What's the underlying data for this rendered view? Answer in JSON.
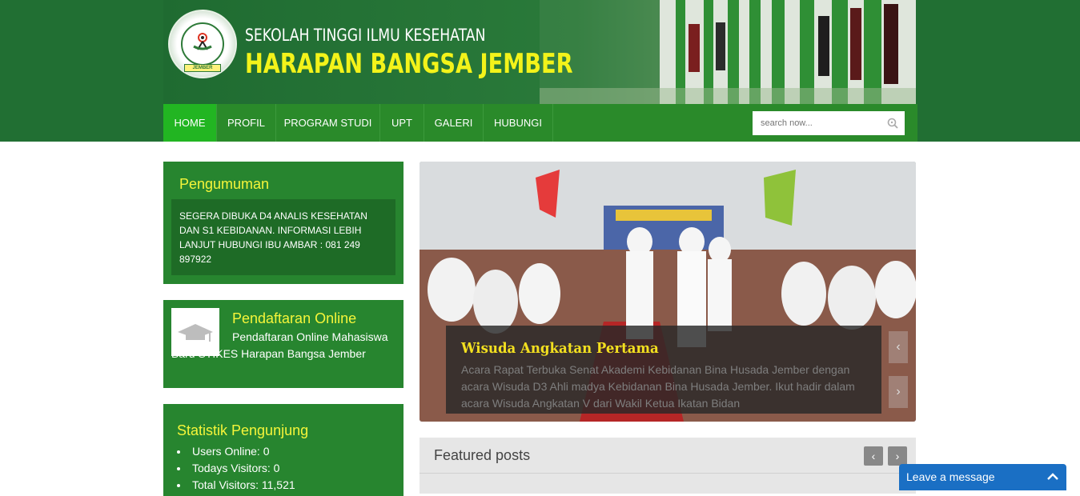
{
  "header": {
    "subtitle": "SEKOLAH TINGGI ILMU KESEHATAN",
    "title": "HARAPAN BANGSA JEMBER",
    "logo_badge": "JEMBER"
  },
  "nav": {
    "items": [
      {
        "label": "HOME"
      },
      {
        "label": "PROFIL"
      },
      {
        "label": "PROGRAM STUDI"
      },
      {
        "label": "UPT"
      },
      {
        "label": "GALERI"
      },
      {
        "label": "HUBUNGI"
      }
    ],
    "active": "HOME"
  },
  "search": {
    "placeholder": "search now..."
  },
  "announcement": {
    "title": "Pengumuman",
    "text": "SEGERA DIBUKA D4 ANALIS KESEHATAN DAN S1 KEBIDANAN. INFORMASI LEBIH LANJUT HUBUNGI IBU AMBAR : 081 249 897922"
  },
  "registration": {
    "title": "Pendaftaran Online",
    "text": "Pendaftaran Online Mahasiswa Baru STIKES Harapan Bangsa Jember"
  },
  "stats": {
    "title": "Statistik Pengunjung",
    "items": [
      {
        "text": "Users Online: 0"
      },
      {
        "text": "Todays Visitors: 0"
      },
      {
        "text": "Total Visitors: 11,521"
      }
    ]
  },
  "slider": {
    "caption_title": "Wisuda Angkatan Pertama",
    "caption_text": "Acara Rapat Terbuka  Senat Akademi Kebidanan Bina Husada Jember dengan acara Wisuda D3 Ahli madya Kebidanan Bina Husada Jember. Ikut hadir dalam acara Wisuda Angkatan V dari Wakil Ketua Ikatan Bidan"
  },
  "featured": {
    "title": "Featured posts"
  },
  "chat": {
    "label": "Leave a message"
  },
  "colors": {
    "header_green": "#216f33",
    "nav_green": "#2a8a2a",
    "nav_active": "#22b522",
    "panel_green": "#27852f",
    "title_yellow": "#f5f53a",
    "chat_blue": "#1a6fc4"
  }
}
